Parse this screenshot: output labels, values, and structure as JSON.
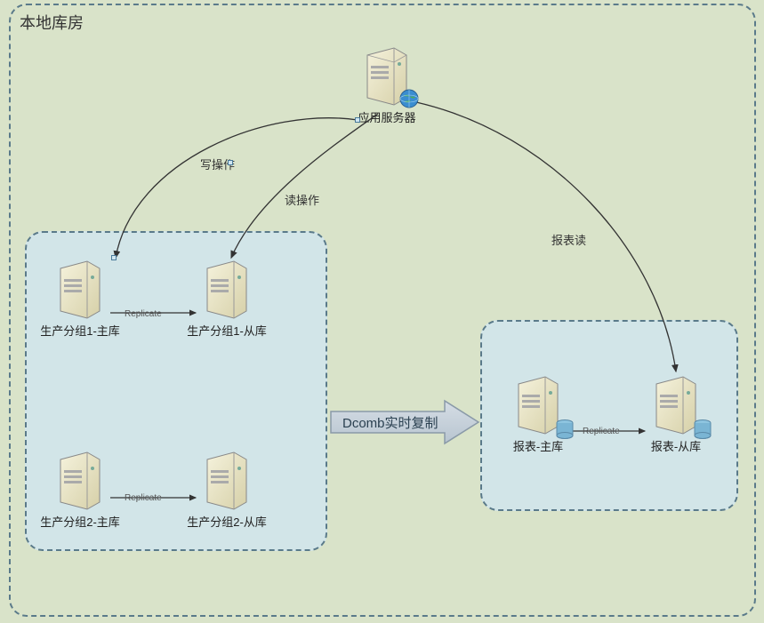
{
  "container": {
    "title": "本地库房"
  },
  "nodes": {
    "app_server": "应用服务器",
    "g1_master": "生产分组1-主库",
    "g1_slave": "生产分组1-从库",
    "g2_master": "生产分组2-主库",
    "g2_slave": "生产分组2-从库",
    "rpt_master": "报表-主库",
    "rpt_slave": "报表-从库"
  },
  "edges": {
    "write": "写操作",
    "read": "读操作",
    "report_read": "报表读",
    "replicate": "Replicate",
    "dcomb": "Dcomb实时复制"
  }
}
